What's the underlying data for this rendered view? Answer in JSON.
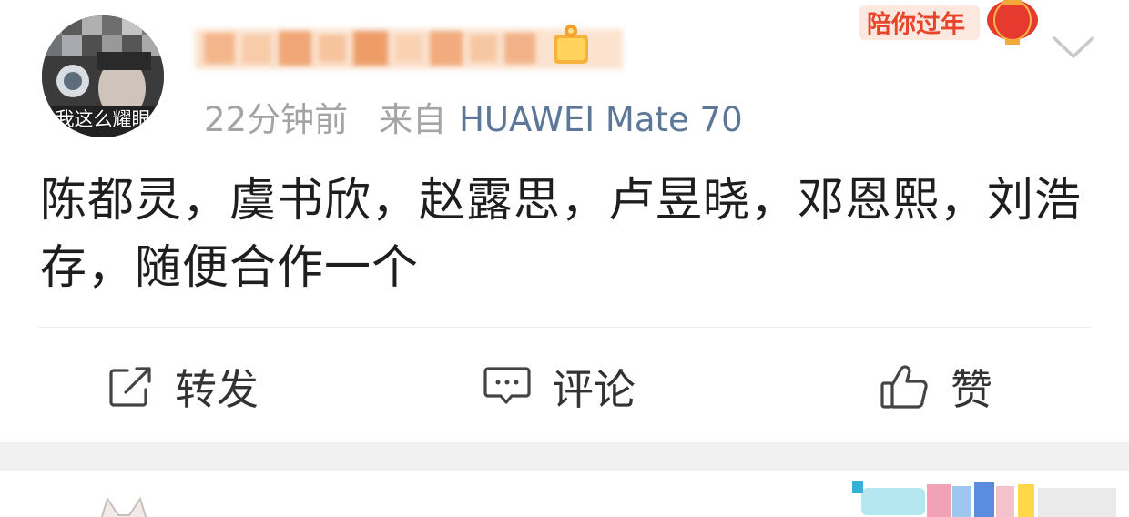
{
  "post": {
    "avatar_caption": "我这么耀眼",
    "meta": {
      "time": "22分钟前",
      "from_label": "来自",
      "device": "HUAWEI Mate 70"
    },
    "holiday_badge": "陪你过年",
    "text": "陈都灵，虞书欣，赵露思，卢昱晓，邓恩熙，刘浩存，随便合作一个"
  },
  "actions": {
    "repost_label": "转发",
    "comment_label": "评论",
    "like_label": "赞"
  },
  "icons": {
    "more": "chevron-down-icon",
    "repost": "repost-icon",
    "comment": "comment-icon",
    "like": "thumbs-up-icon"
  },
  "colors": {
    "meta_gray": "#a4a4a4",
    "device_link": "#5c7798",
    "holiday_red": "#e8452c",
    "text": "#1e1e1e",
    "separator_band": "#f1f1f1"
  }
}
